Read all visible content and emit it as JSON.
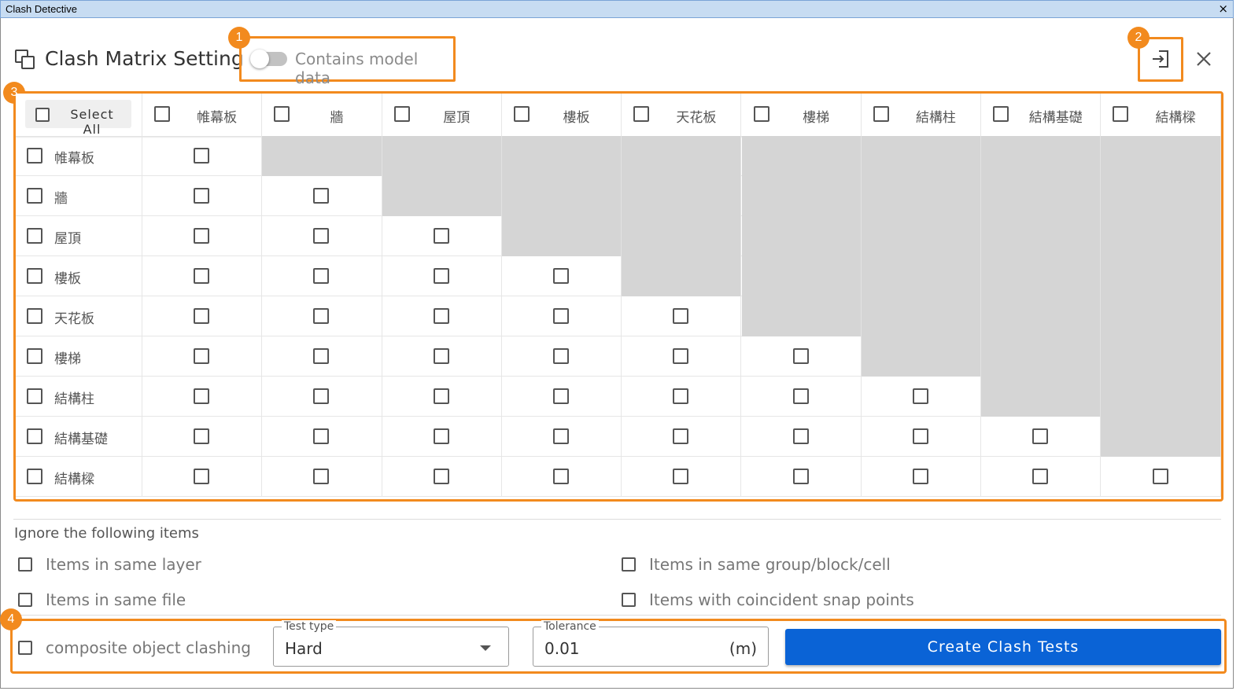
{
  "window": {
    "title": "Clash Detective",
    "close_glyph": "×"
  },
  "header": {
    "title": "Clash Matrix Setting",
    "icon": "copy-squares-icon",
    "toggle_label": "Contains model data",
    "toggle_on": false,
    "export_icon": "export-icon",
    "close_icon": "close-icon"
  },
  "badges": [
    "1",
    "2",
    "3",
    "4"
  ],
  "matrix": {
    "select_all": "Select All",
    "columns": [
      "帷幕板",
      "牆",
      "屋頂",
      "樓板",
      "天花板",
      "樓梯",
      "結構柱",
      "結構基礎",
      "結構樑"
    ],
    "rows": [
      "帷幕板",
      "牆",
      "屋頂",
      "樓板",
      "天花板",
      "樓梯",
      "結構柱",
      "結構基礎",
      "結構樑"
    ]
  },
  "ignore": {
    "title": "Ignore the following items",
    "options": [
      "Items in same layer",
      "Items in same group/block/cell",
      "Items in same file",
      "Items with coincident snap points"
    ]
  },
  "bottom": {
    "composite_label": "composite object clashing",
    "test_type_label": "Test type",
    "test_type_value": "Hard",
    "tolerance_label": "Tolerance",
    "tolerance_value": "0.01",
    "tolerance_unit": "(m)",
    "create_button": "Create Clash Tests"
  },
  "colors": {
    "accent": "#f28a1e",
    "primary_button": "#0a63d6",
    "disabled_cell": "#d5d5d5"
  }
}
